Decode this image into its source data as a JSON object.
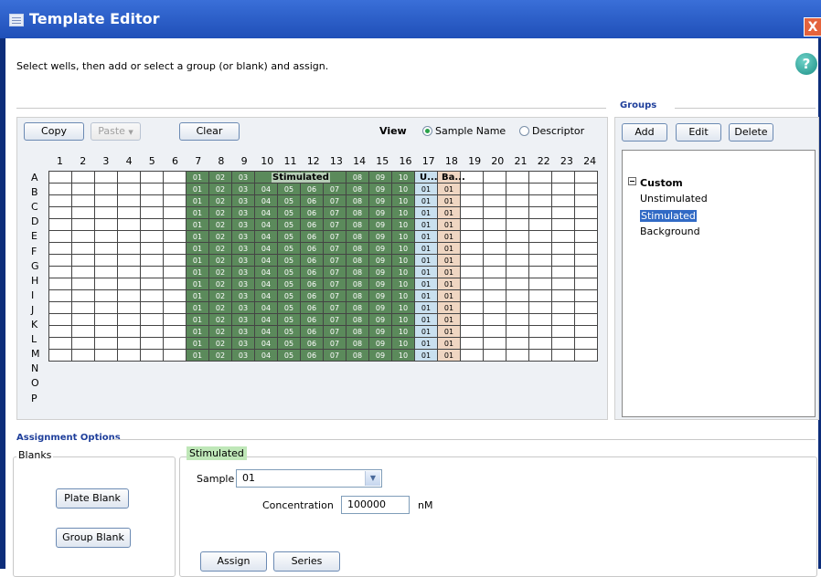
{
  "window": {
    "title": "Template Editor",
    "close_label": "X",
    "help_label": "?"
  },
  "instruction": "Select wells, then add or select a group (or blank) and assign.",
  "toolbar": {
    "copy_label": "Copy",
    "paste_label": "Paste",
    "paste_arrow": "▼",
    "clear_label": "Clear",
    "view_label": "View",
    "view_options": [
      "Sample Name",
      "Descriptor"
    ],
    "view_selected": "Sample Name"
  },
  "plate": {
    "columns": [
      "1",
      "2",
      "3",
      "4",
      "5",
      "6",
      "7",
      "8",
      "9",
      "10",
      "11",
      "12",
      "13",
      "14",
      "15",
      "16",
      "17",
      "18",
      "19",
      "20",
      "21",
      "22",
      "23",
      "24"
    ],
    "rows": [
      "A",
      "B",
      "C",
      "D",
      "E",
      "F",
      "G",
      "H",
      "I",
      "J",
      "K",
      "L",
      "M",
      "N",
      "O",
      "P"
    ],
    "stimulated_wells": [
      "01",
      "02",
      "03",
      "04",
      "05",
      "06",
      "07",
      "08",
      "09",
      "10"
    ],
    "unstimulated_well": "01",
    "background_well": "01",
    "header_labels": {
      "stimulated": "Stimulated",
      "unstimulated": "U...",
      "background": "Ba..."
    },
    "colors": {
      "stimulated": "#5b8a5b",
      "unstimulated": "#c9e0ef",
      "background": "#efd6c2"
    }
  },
  "groups": {
    "heading": "Groups",
    "add_label": "Add",
    "edit_label": "Edit",
    "delete_label": "Delete",
    "tree_root": "Custom",
    "tree_items": [
      "Unstimulated",
      "Stimulated",
      "Background"
    ],
    "selected": "Stimulated"
  },
  "assignment": {
    "heading": "Assignment Options",
    "blanks_heading": "Blanks",
    "plate_blank_label": "Plate Blank",
    "group_blank_label": "Group Blank",
    "group_name": "Stimulated",
    "sample_label": "Sample",
    "sample_value": "01",
    "concentration_label": "Concentration",
    "concentration_value": "100000",
    "unit": "nM",
    "assign_label": "Assign",
    "series_label": "Series"
  }
}
